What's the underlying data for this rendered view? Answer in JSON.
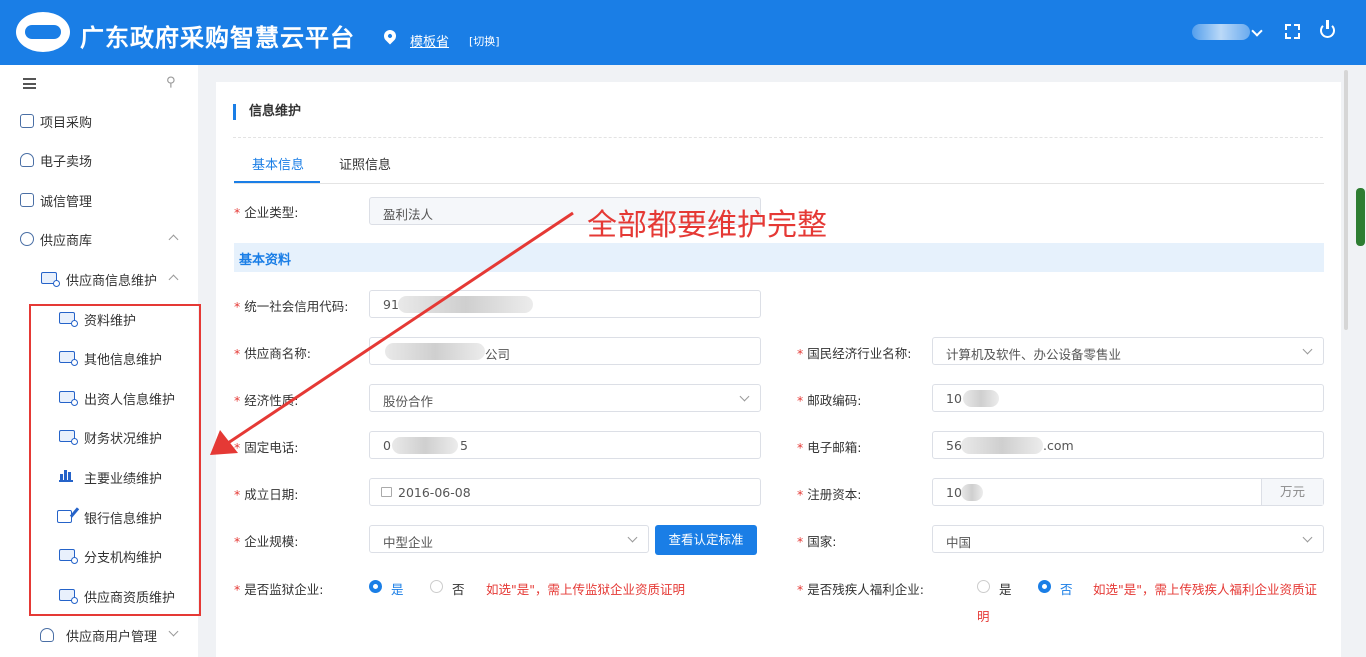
{
  "header": {
    "app_title": "广东政府采购智慧云平台",
    "province": "模板省",
    "switch_label": "[切换]"
  },
  "sidebar": {
    "items": [
      {
        "label": "项目采购",
        "icon": "clipboard-icon"
      },
      {
        "label": "电子卖场",
        "icon": "store-icon"
      },
      {
        "label": "诚信管理",
        "icon": "list-icon"
      },
      {
        "label": "供应商库",
        "icon": "user-icon"
      },
      {
        "label": "供应商信息维护",
        "icon": "info-card-icon"
      }
    ],
    "sub_items": [
      {
        "label": "资料维护"
      },
      {
        "label": "其他信息维护"
      },
      {
        "label": "出资人信息维护"
      },
      {
        "label": "财务状况维护"
      },
      {
        "label": "主要业绩维护"
      },
      {
        "label": "银行信息维护"
      },
      {
        "label": "分支机构维护"
      },
      {
        "label": "供应商资质维护"
      }
    ],
    "last_item": {
      "label": "供应商用户管理"
    }
  },
  "panel": {
    "title": "信息维护",
    "tabs": [
      {
        "label": "基本信息",
        "active": true
      },
      {
        "label": "证照信息",
        "active": false
      }
    ],
    "section_title": "基本资料",
    "annotation": "全部都要维护完整",
    "fields": {
      "enterprise_type": {
        "label": "企业类型:",
        "value": "盈利法人"
      },
      "credit_code": {
        "label": "统一社会信用代码:",
        "value": "91"
      },
      "supplier_name": {
        "label": "供应商名称:",
        "value": "公司"
      },
      "industry": {
        "label": "国民经济行业名称:",
        "value": "计算机及软件、办公设备零售业"
      },
      "economic_nature": {
        "label": "经济性质:",
        "value": "股份合作"
      },
      "postcode": {
        "label": "邮政编码:",
        "value": "10"
      },
      "phone": {
        "label": "固定电话:",
        "value_start": "0",
        "value_end": "5"
      },
      "email": {
        "label": "电子邮箱:",
        "value_start": "56",
        "value_end": ".com"
      },
      "founded": {
        "label": "成立日期:",
        "value": "2016-06-08"
      },
      "capital": {
        "label": "注册资本:",
        "value": "10",
        "unit": "万元"
      },
      "scale": {
        "label": "企业规模:",
        "value": "中型企业"
      },
      "country": {
        "label": "国家:",
        "value": "中国"
      },
      "prison": {
        "label": "是否监狱企业:",
        "yes": "是",
        "no": "否",
        "note": "如选\"是\"，需上传监狱企业资质证明"
      },
      "disabled": {
        "label": "是否残疾人福利企业:",
        "yes": "是",
        "no": "否",
        "note": "如选\"是\"，需上传残疾人福利企业资质证",
        "note_wrap": "明"
      }
    },
    "standard_button": "查看认定标准"
  },
  "colors": {
    "primary": "#1a7ee6",
    "annotation_red": "#e53935"
  }
}
